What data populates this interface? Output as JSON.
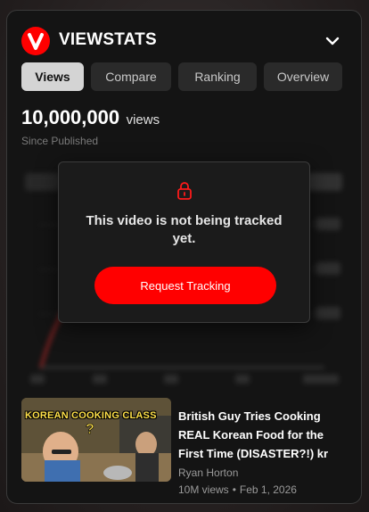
{
  "header": {
    "app_title": "VIEWSTATS",
    "logo_letter": "V",
    "collapse_icon": "chevron-down-icon"
  },
  "tabs": [
    {
      "label": "Views",
      "active": true
    },
    {
      "label": "Compare",
      "active": false
    },
    {
      "label": "Ranking",
      "active": false
    },
    {
      "label": "Overview",
      "active": false
    }
  ],
  "stats": {
    "views_number": "10,000,000",
    "views_unit": "views",
    "subtitle": "Since Published"
  },
  "tracking_overlay": {
    "icon": "lock-icon",
    "message": "This video is not being tracked yet.",
    "button_label": "Request Tracking"
  },
  "video": {
    "thumbnail_text": "KOREAN COOKING CLASS",
    "title": "British Guy Tries Cooking REAL Korean Food for the First Time (DISASTER?!) kr",
    "channel": "Ryan Horton",
    "views": "10M views",
    "date": "Feb 1, 2026"
  },
  "colors": {
    "brand_red": "#ff0000",
    "panel_bg": "#141414",
    "tab_active_bg": "#d4d4d4",
    "tab_bg": "#2a2a2a"
  }
}
